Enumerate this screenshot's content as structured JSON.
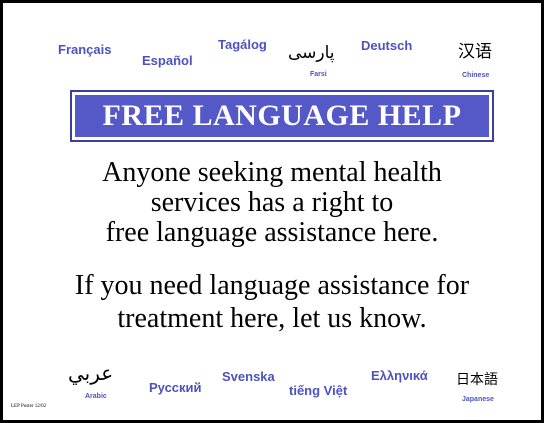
{
  "top_languages": {
    "french": "Français",
    "spanish": "Español",
    "tagalog": "Tagálog",
    "farsi_native": "پارسی",
    "farsi_label": "Farsi",
    "german": "Deutsch",
    "chinese_native": "汉语",
    "chinese_label": "Chinese"
  },
  "banner": {
    "title": "FREE LANGUAGE HELP"
  },
  "message": {
    "line1": "Anyone seeking mental health",
    "line2": "services has a right to",
    "line3": "free language assistance here.",
    "line4": "If you need language assistance for",
    "line5": "treatment here, let us know."
  },
  "bottom_languages": {
    "arabic_native": "عربي",
    "arabic_label": "Arabic",
    "russian": "Русский",
    "swedish": "Svenska",
    "vietnamese": "tiếng Việt",
    "greek": "Ελληνικά",
    "japanese_native": "日本語",
    "japanese_label": "Japanese"
  },
  "footer": {
    "note": "LEP Poster 12/02"
  },
  "colors": {
    "accent": "#4c53bf",
    "banner_fill": "#5559c8",
    "border": "#000000"
  }
}
